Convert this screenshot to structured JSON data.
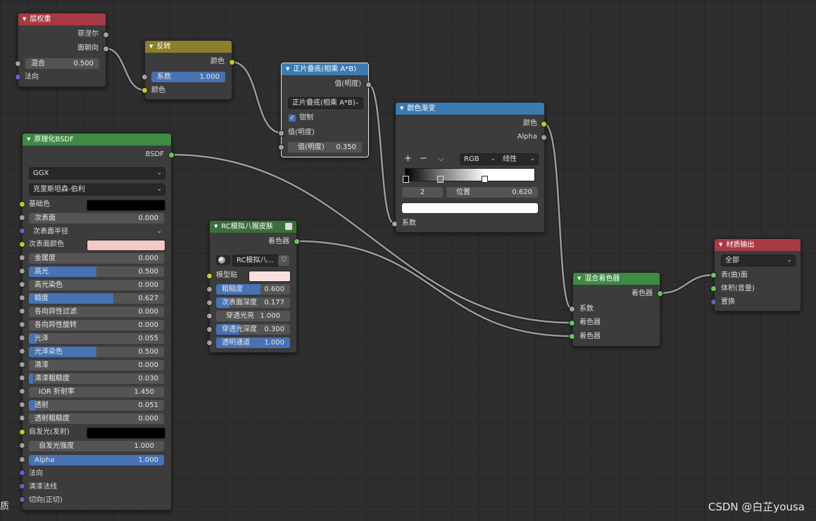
{
  "nodes": {
    "layer_weight": {
      "title": "层权重",
      "outputs": [
        "菲涅尔",
        "面朝向"
      ],
      "blend_label": "混合",
      "blend_value": "0.500",
      "normal_label": "法向"
    },
    "invert": {
      "title": "反转",
      "output": "颜色",
      "factor_label": "系数",
      "factor_value": "1.000",
      "color_label": "颜色"
    },
    "multiply": {
      "title": "正片叠底(相乘 A*B)",
      "output": "值(明度)",
      "mode_value": "正片叠底(相乘 A*B)",
      "clamp_label": "钳制",
      "input1_label": "值(明度)",
      "input2_label": "值(明度)",
      "input2_value": "0.350"
    },
    "color_ramp": {
      "title": "颜色渐变",
      "outputs": [
        "颜色",
        "Alpha"
      ],
      "add_glyph": "+",
      "remove_glyph": "−",
      "menu_glyph": "⌵",
      "color_mode": "RGB",
      "interpolation": "线性",
      "stop_index": "2",
      "position_label": "位置",
      "position_value": "0.620",
      "factor_label": "系数"
    },
    "principled": {
      "title": "原理化BSDF",
      "output": "BSDF",
      "distribution": "GGX",
      "subsurface_method": "克里斯坦森-伯利",
      "base_color_label": "基础色",
      "subsurface_label": "次表面",
      "subsurface_value": "0.000",
      "subsurface_radius_label": "次表面半径",
      "subsurface_color_label": "次表面颜色",
      "metallic_label": "金属度",
      "metallic_value": "0.000",
      "specular_label": "高光",
      "specular_value": "0.500",
      "specular_tint_label": "高光染色",
      "specular_tint_value": "0.000",
      "roughness_label": "糙度",
      "roughness_value": "0.627",
      "anisotropic_label": "各向异性过滤",
      "anisotropic_value": "0.000",
      "anisotropic_rotation_label": "各向异性旋转",
      "anisotropic_rotation_value": "0.000",
      "sheen_label": "光泽",
      "sheen_value": "0.055",
      "sheen_tint_label": "光泽染色",
      "sheen_tint_value": "0.500",
      "clearcoat_label": "清漆",
      "clearcoat_value": "0.000",
      "clearcoat_roughness_label": "清漆粗糙度",
      "clearcoat_roughness_value": "0.030",
      "ior_label": "IOR 折射率",
      "ior_value": "1.450",
      "transmission_label": "透射",
      "transmission_value": "0.051",
      "transmission_roughness_label": "透射粗糙度",
      "transmission_roughness_value": "0.000",
      "emission_label": "自发光(发射)",
      "emission_strength_label": "自发光强度",
      "emission_strength_value": "1.000",
      "alpha_label": "Alpha",
      "alpha_value": "1.000",
      "normal_label": "法向",
      "clearcoat_normal_label": "清漆法线",
      "tangent_label": "切向(正切)"
    },
    "rc_group": {
      "title": "RC模拟八猴皮肤",
      "output": "着色器",
      "group_name": "RC模拟八...",
      "model_label": "模型贴",
      "roughness_label": "粗糙度",
      "roughness_value": "0.600",
      "subsurface_depth_label": "次表面深度",
      "subsurface_depth_value": "0.177",
      "translucency_label": "穿透光亮",
      "translucency_value": "1.000",
      "translucency_depth_label": "穿透光深度",
      "translucency_depth_value": "0.300",
      "transparency_label": "透明通道",
      "transparency_value": "1.000"
    },
    "mix_shader": {
      "title": "混合着色器",
      "output": "着色器",
      "factor_label": "系数",
      "shader1_label": "着色器",
      "shader2_label": "着色器"
    },
    "material_output": {
      "title": "材质输出",
      "target": "全部",
      "surface_label": "表(曲)面",
      "volume_label": "体积(音量)",
      "displacement_label": "置换"
    }
  },
  "fill_levels": {
    "specular": 0.5,
    "roughness": 0.627,
    "sheen": 0.055,
    "sheen_tint": 0.5,
    "clearcoat_roughness": 0.03,
    "transmission": 0.051,
    "alpha": 1.0,
    "rc_roughness": 0.6,
    "rc_subsurface_depth": 0.177,
    "rc_translucency_depth": 0.3,
    "rc_transparency": 1.0,
    "invert_factor": 1.0
  },
  "colors": {
    "base_color": "#000000",
    "subsurface_color": "#f2c9c4",
    "emission": "#000000",
    "model_color": "#f7e0de",
    "accent": "#4772b3"
  },
  "side_label": "质",
  "watermark": "CSDN @白芷yousa"
}
